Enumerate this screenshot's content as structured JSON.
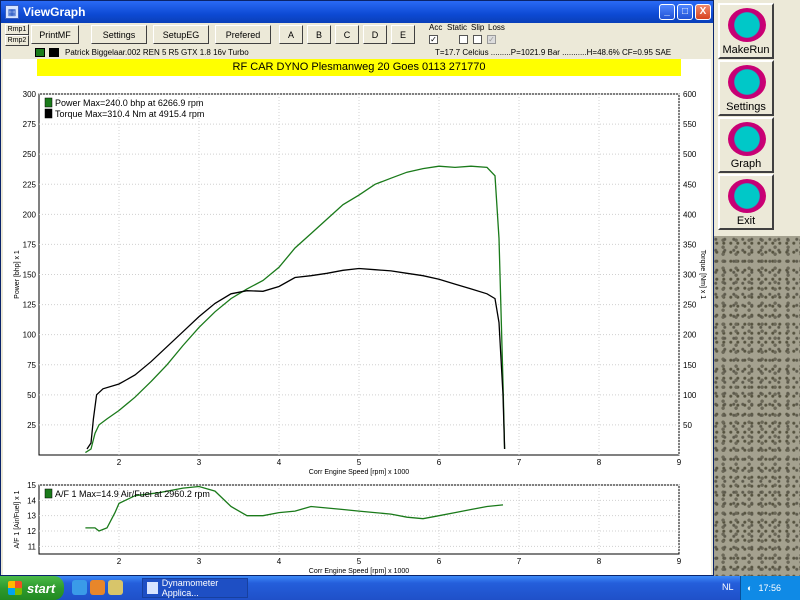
{
  "window": {
    "title": "ViewGraph",
    "minimize": "_",
    "maximize": "□",
    "close": "X"
  },
  "toolbar": {
    "small_buttons": [
      "Rmp1",
      "Rmp2"
    ],
    "buttons": [
      "PrintMF",
      "Settings",
      "SetupEG",
      "Prefered",
      "A",
      "B",
      "C",
      "D",
      "E"
    ]
  },
  "flags": {
    "labels": [
      "Acc",
      "Static",
      "Slip",
      "Loss"
    ],
    "states": [
      "✓",
      "",
      "",
      "✓"
    ]
  },
  "info": {
    "run": "Patrick Biggelaar.002 REN 5   R5 GTX 1.8 16v Turbo",
    "conditions": "T=17.7 Celcius .........P=1021.9 Bar ...........H=48.6% CF=0.95 SAE"
  },
  "banner": "RF CAR DYNO  Plesmanweg 20 Goes  0113 271770",
  "colors": {
    "power": "#1a7a1a",
    "torque": "#000000",
    "af": "#1a7a1a",
    "banner": "#ffff00"
  },
  "chart_data": [
    {
      "type": "line",
      "xlabel": "Corr Engine Speed [rpm] x 1000",
      "ylabel": "Power [bhp] x 1",
      "y2label": "Torque [Nm] x 1",
      "xlim": [
        1.0,
        9.0
      ],
      "ylim": [
        0,
        300
      ],
      "y2lim": [
        0,
        600
      ],
      "xticks": [
        "2",
        "3",
        "4",
        "5",
        "6",
        "7",
        "8",
        "9"
      ],
      "yticks": [
        "25",
        "50",
        "75",
        "100",
        "125",
        "150",
        "175",
        "200",
        "225",
        "250",
        "275",
        "300"
      ],
      "y2ticks": [
        "50",
        "100",
        "150",
        "200",
        "250",
        "300",
        "350",
        "400",
        "450",
        "500",
        "550",
        "600"
      ],
      "legend": [
        "Power  Max=240.0 bhp at 6266.9 rpm",
        "Torque  Max=310.4 Nm at 4915.4 rpm"
      ],
      "grid": true,
      "series": [
        {
          "name": "Power  Max=240.0 bhp at 6266.9 rpm",
          "axis": "left",
          "x": [
            1.58,
            1.65,
            1.7,
            1.75,
            1.85,
            2.0,
            2.2,
            2.4,
            2.6,
            2.8,
            3.0,
            3.2,
            3.4,
            3.6,
            3.8,
            4.0,
            4.2,
            4.4,
            4.6,
            4.8,
            5.0,
            5.2,
            5.4,
            5.6,
            5.8,
            6.0,
            6.2,
            6.4,
            6.6,
            6.7,
            6.75,
            6.8,
            6.82
          ],
          "y": [
            2,
            5,
            18,
            25,
            30,
            37,
            48,
            61,
            75,
            91,
            106,
            119,
            130,
            138,
            145,
            156,
            172,
            184,
            196,
            208,
            216,
            225,
            230,
            235,
            238,
            240,
            239,
            240,
            239,
            232,
            180,
            60,
            5
          ]
        },
        {
          "name": "Torque  Max=310.4 Nm at 4915.4 rpm",
          "axis": "right",
          "x": [
            1.6,
            1.65,
            1.68,
            1.72,
            1.8,
            2.0,
            2.2,
            2.4,
            2.6,
            2.8,
            3.0,
            3.2,
            3.4,
            3.6,
            3.8,
            4.0,
            4.2,
            4.4,
            4.6,
            4.8,
            5.0,
            5.2,
            5.4,
            5.6,
            5.8,
            6.0,
            6.2,
            6.4,
            6.6,
            6.7,
            6.75,
            6.8,
            6.82
          ],
          "y": [
            10,
            20,
            60,
            100,
            110,
            118,
            133,
            155,
            180,
            205,
            230,
            252,
            268,
            273,
            272,
            280,
            295,
            298,
            302,
            307,
            310,
            308,
            306,
            302,
            298,
            292,
            284,
            276,
            268,
            260,
            220,
            100,
            10
          ]
        }
      ]
    },
    {
      "type": "line",
      "xlabel": "Corr Engine Speed [rpm] x 1000",
      "ylabel": "A/F 1 [Air/Fuel] x 1",
      "xlim": [
        1.0,
        9.0
      ],
      "ylim": [
        10.5,
        15
      ],
      "xticks": [
        "2",
        "3",
        "4",
        "5",
        "6",
        "7",
        "8",
        "9"
      ],
      "yticks": [
        "11",
        "12",
        "13",
        "14",
        "15"
      ],
      "legend": [
        "A/F 1  Max=14.9 Air/Fuel at 2960.2 rpm"
      ],
      "grid": true,
      "series": [
        {
          "name": "A/F 1  Max=14.9 Air/Fuel at 2960.2 rpm",
          "x": [
            1.58,
            1.7,
            1.75,
            1.85,
            1.95,
            2.0,
            2.2,
            2.5,
            2.8,
            3.0,
            3.2,
            3.4,
            3.6,
            3.8,
            4.0,
            4.2,
            4.4,
            4.6,
            4.8,
            5.0,
            5.2,
            5.4,
            5.6,
            5.8,
            6.0,
            6.2,
            6.4,
            6.6,
            6.8
          ],
          "y": [
            12.2,
            12.2,
            12.0,
            12.2,
            13.2,
            13.8,
            14.3,
            14.5,
            14.8,
            14.9,
            14.6,
            13.6,
            13.0,
            13.0,
            13.2,
            13.3,
            13.6,
            13.5,
            13.4,
            13.3,
            13.2,
            13.1,
            12.9,
            12.8,
            13.0,
            13.2,
            13.4,
            13.6,
            13.7
          ]
        }
      ]
    }
  ],
  "panel": {
    "buttons": [
      "MakeRun",
      "Settings",
      "Graph",
      "Exit"
    ]
  },
  "taskbar": {
    "start": "start",
    "task": "Dynamometer Applica...",
    "lang": "NL",
    "clock": "17:56"
  }
}
